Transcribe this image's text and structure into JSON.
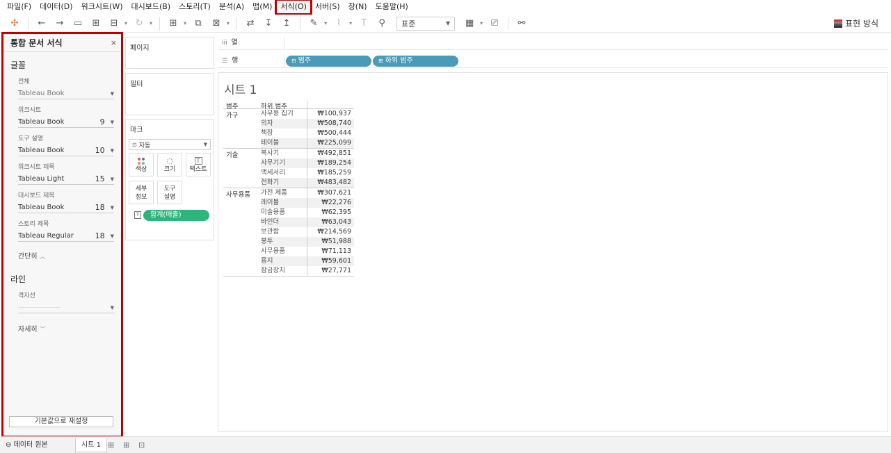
{
  "menu": [
    "파일(F)",
    "데이터(D)",
    "워크시트(W)",
    "대시보드(B)",
    "스토리(T)",
    "분석(A)",
    "맵(M)",
    "서식(O)",
    "서버(S)",
    "창(N)",
    "도움말(H)"
  ],
  "toolbar": {
    "fit_select": "표준",
    "show_me": "표현 방식"
  },
  "format_panel": {
    "title": "통합 문서 서식",
    "close": "×",
    "fonts_section": "글꼴",
    "fields": [
      {
        "label": "전체",
        "font": "Tableau Book",
        "size": ""
      },
      {
        "label": "워크시트",
        "font": "Tableau Book",
        "size": "9"
      },
      {
        "label": "도구 설명",
        "font": "Tableau Book",
        "size": "10"
      },
      {
        "label": "워크시트 제목",
        "font": "Tableau Light",
        "size": "15"
      },
      {
        "label": "대시보드 제목",
        "font": "Tableau Book",
        "size": "18"
      },
      {
        "label": "스토리 제목",
        "font": "Tableau Regular",
        "size": "18"
      }
    ],
    "collapse_label": "간단히",
    "lines_section": "라인",
    "gridline_label": "격자선",
    "details_label": "자세히",
    "reset_button": "기본값으로 재설정"
  },
  "cards": {
    "pages": "페이지",
    "filters": "필터",
    "marks": "마크",
    "marks_type": "자동",
    "buttons": [
      {
        "label": "색상"
      },
      {
        "label": "크기"
      },
      {
        "label": "텍스트"
      },
      {
        "label": "세부 정보"
      },
      {
        "label": "도구 설명"
      }
    ],
    "measure_pill": "합계(매출)"
  },
  "shelves": {
    "columns_label": "열",
    "rows_label": "행",
    "row_pills": [
      "범주",
      "하위 범주"
    ]
  },
  "sheet": {
    "title": "시트 1",
    "headers": [
      "범주",
      "하위 범주",
      ""
    ],
    "groups": [
      {
        "category": "가구",
        "rows": [
          {
            "sub": "사무용 집기",
            "value": "₩100,937"
          },
          {
            "sub": "의자",
            "value": "₩508,740"
          },
          {
            "sub": "책장",
            "value": "₩500,444"
          },
          {
            "sub": "테이블",
            "value": "₩225,099"
          }
        ]
      },
      {
        "category": "기술",
        "rows": [
          {
            "sub": "복사기",
            "value": "₩492,851"
          },
          {
            "sub": "사무기기",
            "value": "₩189,254"
          },
          {
            "sub": "액세서리",
            "value": "₩185,259"
          },
          {
            "sub": "전화기",
            "value": "₩483,482"
          }
        ]
      },
      {
        "category": "사무용품",
        "rows": [
          {
            "sub": "가전 제품",
            "value": "₩307,621"
          },
          {
            "sub": "레이블",
            "value": "₩22,276"
          },
          {
            "sub": "미술용품",
            "value": "₩62,395"
          },
          {
            "sub": "바인더",
            "value": "₩63,043"
          },
          {
            "sub": "보관함",
            "value": "₩214,569"
          },
          {
            "sub": "봉투",
            "value": "₩51,988"
          },
          {
            "sub": "사무용품",
            "value": "₩71,113"
          },
          {
            "sub": "용지",
            "value": "₩59,601"
          },
          {
            "sub": "잠금장치",
            "value": "₩27,771"
          }
        ]
      }
    ]
  },
  "tabs": {
    "data_source": "데이터 원본",
    "sheet": "시트 1"
  },
  "colors": {
    "highlight": "#c00000",
    "pill_blue": "#4a9ab8",
    "pill_green": "#2db67c"
  }
}
